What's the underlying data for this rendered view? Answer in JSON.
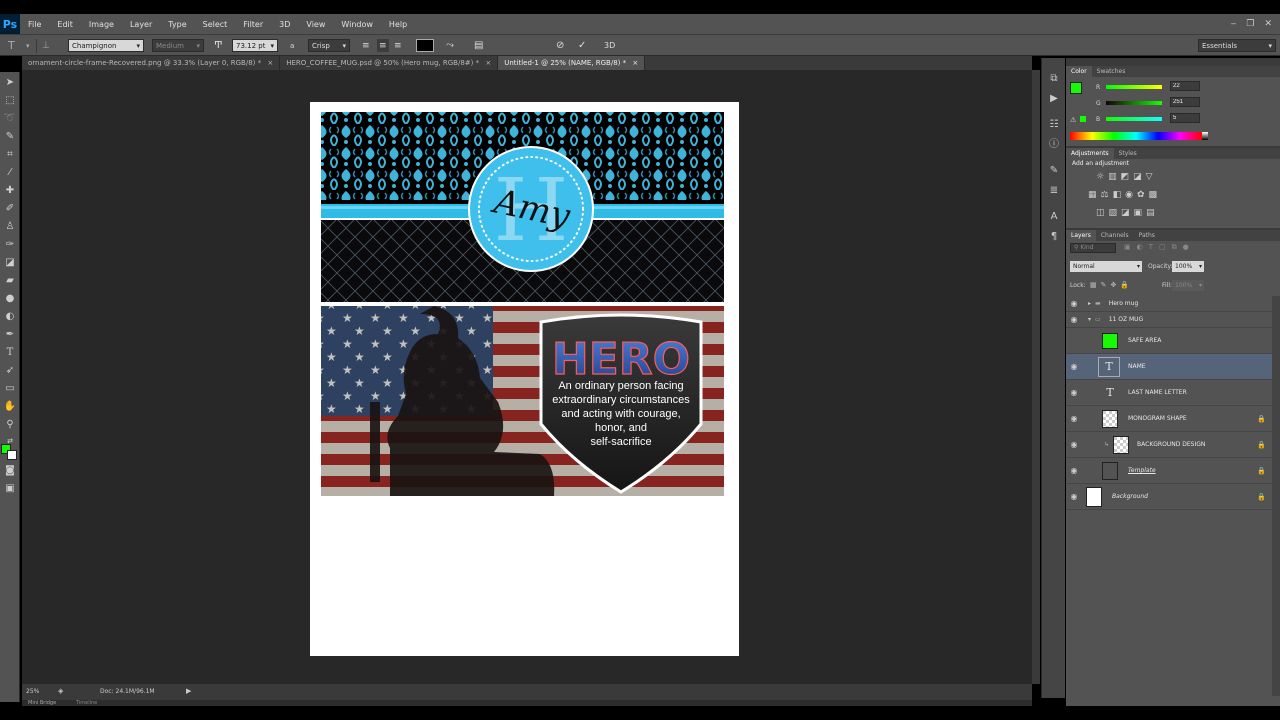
{
  "app": {
    "logo": "Ps"
  },
  "menu": [
    "File",
    "Edit",
    "Image",
    "Layer",
    "Type",
    "Select",
    "Filter",
    "3D",
    "View",
    "Window",
    "Help"
  ],
  "options": {
    "font_family": "Champignon",
    "font_style": "Medium",
    "font_size": "73.12 pt",
    "aa_label": "a",
    "antialias": "Crisp",
    "label_3d": "3D",
    "workspace": "Essentials"
  },
  "tabs": [
    {
      "label": "ornament-circle-frame-Recovered.png @ 33.3% (Layer 0, RGB/8) *",
      "active": false
    },
    {
      "label": "HERO_COFFEE_MUG.psd @ 50% (Hero mug, RGB/8#) *",
      "active": false
    },
    {
      "label": "Untitled-1 @ 25% (NAME, RGB/8) *",
      "active": true
    }
  ],
  "document": {
    "monogram_letter": "H",
    "monogram_name": "Amy",
    "hero_title": "HERO",
    "hero_text": [
      "An ordinary person facing",
      "extraordinary circumstances",
      "and acting with courage,",
      "honor, and",
      "self-sacrifice"
    ]
  },
  "status": {
    "zoom": "25%",
    "doc_info": "Doc: 24.1M/96.1M",
    "mini_bridge": "Mini Bridge",
    "timeline": "Timeline"
  },
  "color_panel": {
    "tabs": [
      "Color",
      "Swatches"
    ],
    "r_label": "R",
    "g_label": "G",
    "b_label": "B",
    "r": "22",
    "g": "251",
    "b": "5",
    "foreground": "#16fb05"
  },
  "adjustments_panel": {
    "tabs": [
      "Adjustments",
      "Styles"
    ],
    "heading": "Add an adjustment"
  },
  "layers_panel": {
    "tabs": [
      "Layers",
      "Channels",
      "Paths"
    ],
    "filter": "Kind",
    "blend_mode": "Normal",
    "opacity_label": "Opacity:",
    "opacity": "100%",
    "lock_label": "Lock:",
    "fill_label": "Fill:",
    "fill": "100%",
    "layers": [
      {
        "name": "Hero mug",
        "kind": "group",
        "visible": true,
        "expanded": false,
        "indent": 0,
        "locked": false,
        "selected": false
      },
      {
        "name": "11 OZ MUG",
        "kind": "group",
        "visible": true,
        "expanded": true,
        "indent": 0,
        "locked": false,
        "selected": false
      },
      {
        "name": "SAFE AREA",
        "kind": "pixel-green",
        "visible": false,
        "indent": 1,
        "locked": false,
        "selected": false
      },
      {
        "name": "NAME",
        "kind": "text",
        "visible": true,
        "indent": 1,
        "locked": false,
        "selected": true
      },
      {
        "name": "LAST NAME LETTER",
        "kind": "text",
        "visible": true,
        "indent": 1,
        "locked": false,
        "selected": false
      },
      {
        "name": "MONOGRAM SHAPE",
        "kind": "pixel-checker",
        "visible": true,
        "indent": 1,
        "locked": true,
        "selected": false
      },
      {
        "name": "BACKGROUND DESIGN",
        "kind": "pixel-checker",
        "visible": true,
        "indent": 2,
        "locked": true,
        "selected": false
      },
      {
        "name": "Template",
        "kind": "pixel-black",
        "visible": true,
        "indent": 1,
        "locked": true,
        "selected": false
      },
      {
        "name": "Background",
        "kind": "pixel-white",
        "visible": true,
        "indent": 0,
        "locked": true,
        "selected": false
      }
    ]
  }
}
